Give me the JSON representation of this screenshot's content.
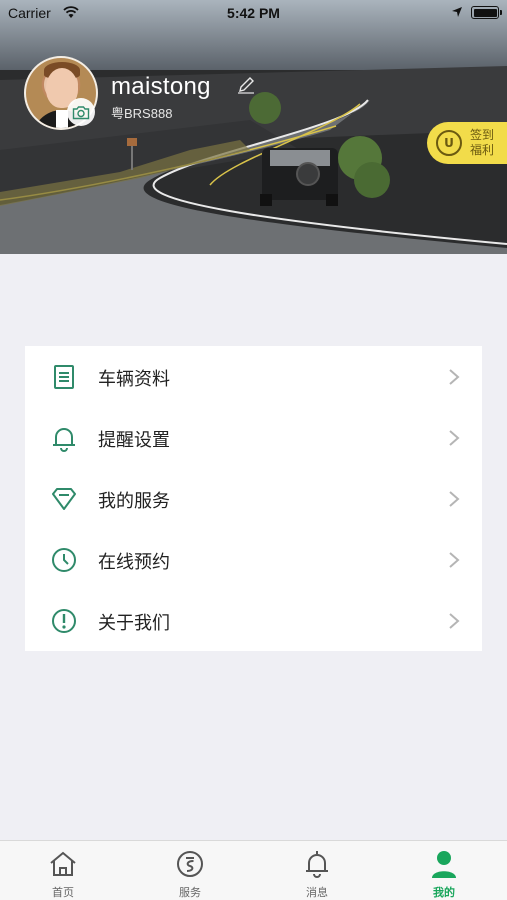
{
  "status_bar": {
    "carrier": "Carrier",
    "time": "5:42 PM"
  },
  "profile": {
    "username": "maistong",
    "plate": "粤BRS888"
  },
  "checkin": {
    "badge": "U",
    "line1": "签到",
    "line2": "福利"
  },
  "menu": {
    "items": [
      {
        "label": "车辆资料",
        "icon": "document-icon"
      },
      {
        "label": "提醒设置",
        "icon": "bell-icon"
      },
      {
        "label": "我的服务",
        "icon": "diamond-icon"
      },
      {
        "label": "在线预约",
        "icon": "clock-icon"
      },
      {
        "label": "关于我们",
        "icon": "info-icon"
      }
    ]
  },
  "tabbar": {
    "tabs": [
      {
        "label": "首页",
        "icon": "home-icon"
      },
      {
        "label": "服务",
        "icon": "service-icon"
      },
      {
        "label": "消息",
        "icon": "bell-icon"
      },
      {
        "label": "我的",
        "icon": "person-icon",
        "active": true
      }
    ]
  },
  "colors": {
    "accent": "#19a65c",
    "icon_green": "#2f8a6a",
    "checkin_yellow": "#f2dc4a"
  }
}
